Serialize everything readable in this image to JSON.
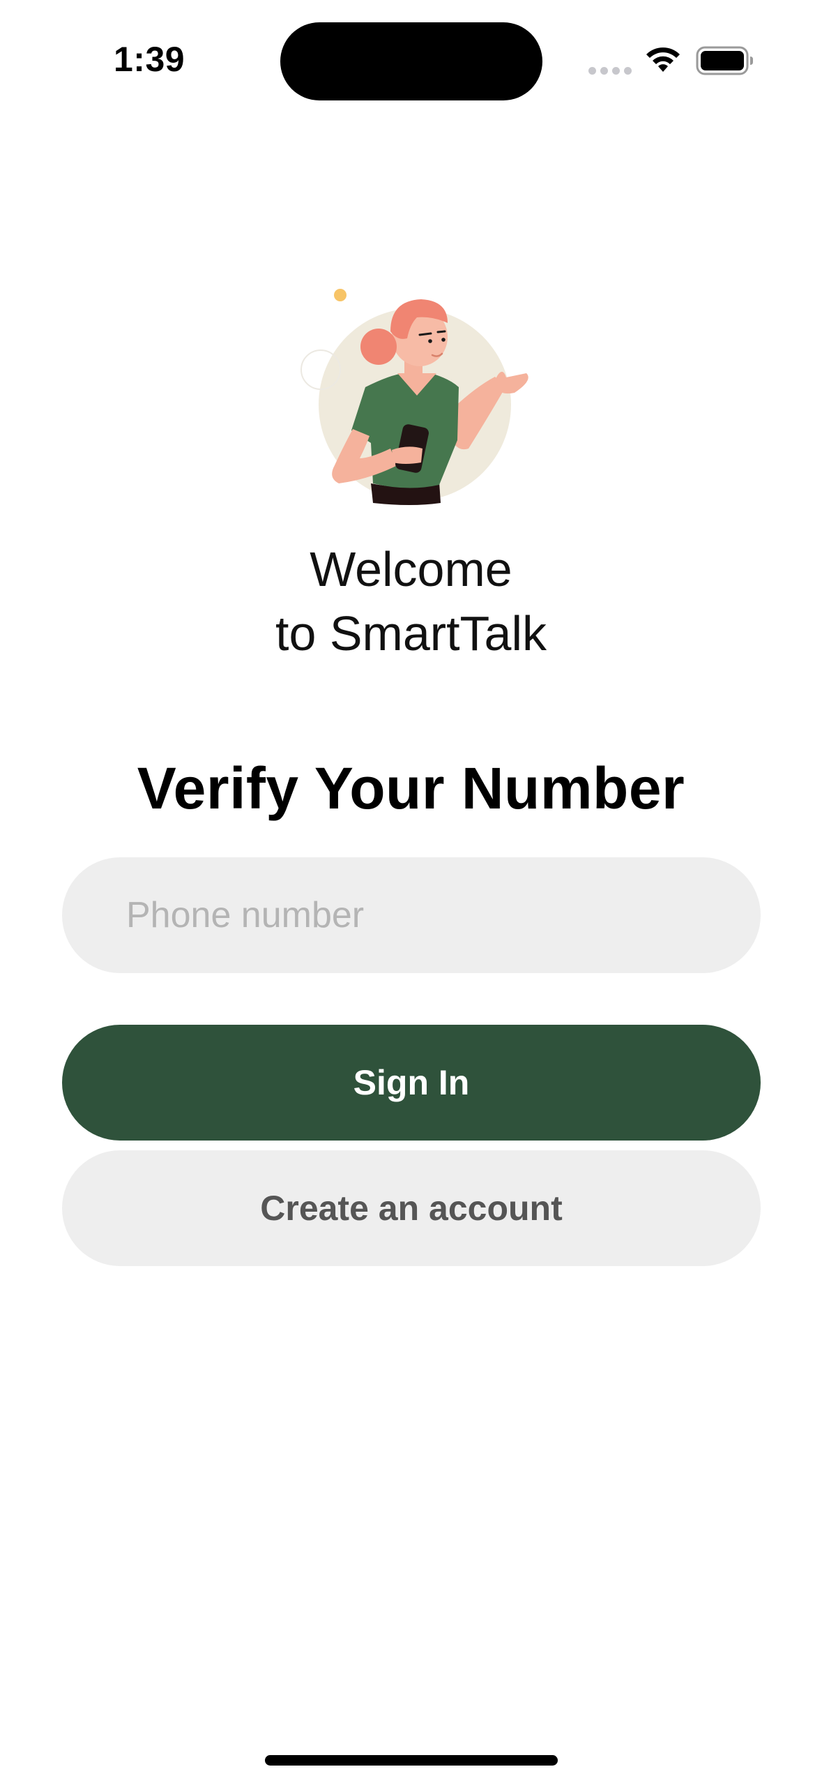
{
  "status_bar": {
    "time": "1:39"
  },
  "welcome": {
    "line1": "Welcome",
    "line2": "to SmartTalk"
  },
  "verify": {
    "title": "Verify Your Number"
  },
  "phone_input": {
    "placeholder": "Phone number",
    "value": ""
  },
  "buttons": {
    "sign_in": "Sign In",
    "create_account": "Create an account"
  },
  "colors": {
    "primary": "#2f523b",
    "field_background": "#eeeeee",
    "placeholder": "#b4b4b4",
    "secondary_text": "#555555"
  },
  "icons": {
    "wifi": "wifi-icon",
    "battery": "battery-icon",
    "cellular": "cellular-signal-icon",
    "illustration": "woman-holding-phone-illustration"
  }
}
